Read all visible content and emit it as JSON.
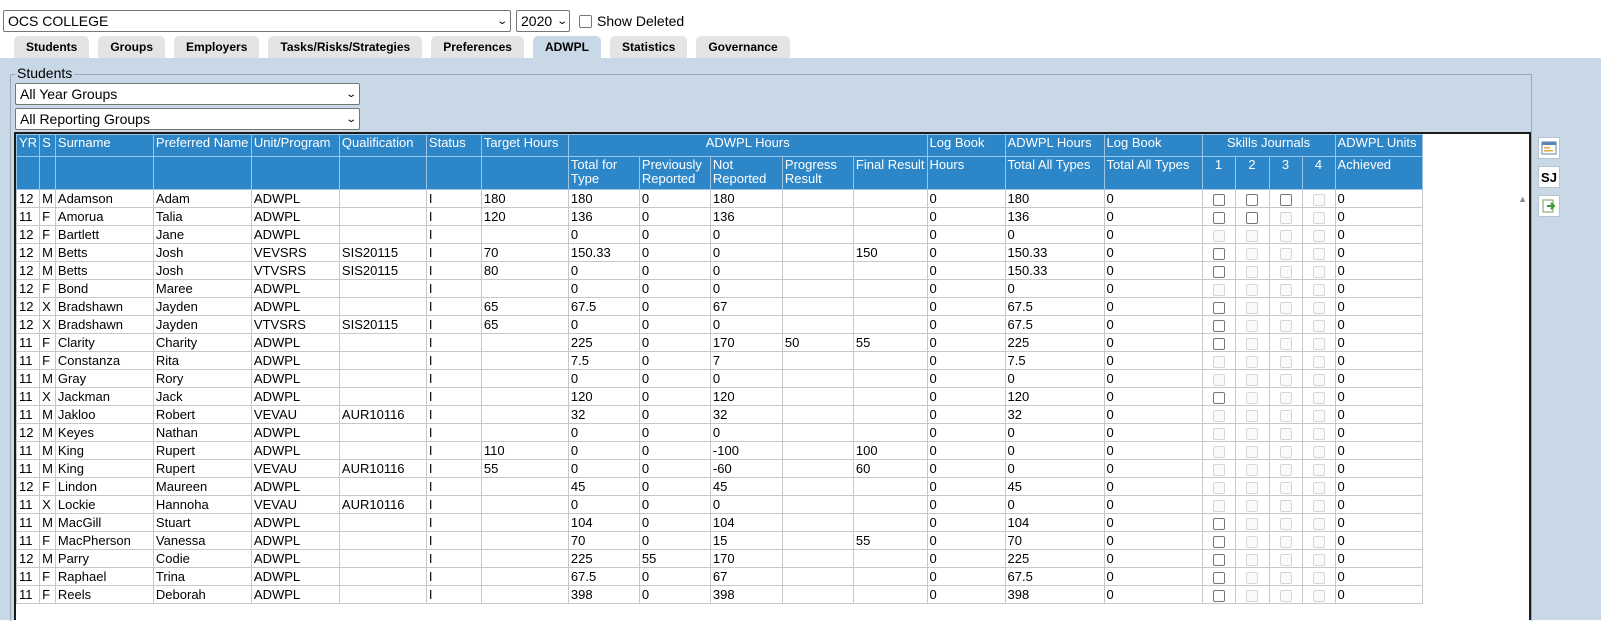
{
  "top": {
    "college": "OCS COLLEGE",
    "year": "2020",
    "show_deleted_label": "Show Deleted"
  },
  "tabs": [
    {
      "label": "Students",
      "active": false
    },
    {
      "label": "Groups",
      "active": false
    },
    {
      "label": "Employers",
      "active": false
    },
    {
      "label": "Tasks/Risks/Strategies",
      "active": false
    },
    {
      "label": "Preferences",
      "active": false
    },
    {
      "label": "ADWPL",
      "active": true
    },
    {
      "label": "Statistics",
      "active": false
    },
    {
      "label": "Governance",
      "active": false
    }
  ],
  "students_section": {
    "legend": "Students",
    "year_group_filter": "All Year Groups",
    "reporting_group_filter": "All Reporting Groups"
  },
  "headers": {
    "yr": "YR",
    "s": "S",
    "surname": "Surname",
    "preferred_name": "Preferred Name",
    "unit_program": "Unit/Program",
    "qualification": "Qualification",
    "status": "Status",
    "target_hours": "Target Hours",
    "adwpl_hours_group": "ADWPL Hours",
    "log_book_group": "Log Book",
    "adwpl_hours_group2": "ADWPL Hours",
    "log_book_group2": "Log Book",
    "skills_journals": "Skills Journals",
    "adwpl_units": "ADWPL Units",
    "total_for_type": "Total for Type",
    "previously_reported": "Previously Reported",
    "not_reported": "Not Reported",
    "progress_result": "Progress Result",
    "final_result": "Final Result",
    "hours": "Hours",
    "total_all_types": "Total All Types",
    "total_all_types2": "Total All Types",
    "sj1": "1",
    "sj2": "2",
    "sj3": "3",
    "sj4": "4",
    "achieved": "Achieved"
  },
  "rows": [
    {
      "yr": "12",
      "s": "M",
      "surname": "Adamson",
      "pref": "Adam",
      "unit": "ADWPL",
      "qual": "",
      "status": "I",
      "target": "180",
      "total": "180",
      "prev": "0",
      "notrep": "180",
      "progress": "",
      "final": "",
      "logbook": "0",
      "adwpl_all": "180",
      "logbook_all": "0",
      "sj": [
        "e",
        "e",
        "e",
        "d"
      ],
      "units": "0"
    },
    {
      "yr": "11",
      "s": "F",
      "surname": "Amorua",
      "pref": "Talia",
      "unit": "ADWPL",
      "qual": "",
      "status": "I",
      "target": "120",
      "total": "136",
      "prev": "0",
      "notrep": "136",
      "progress": "",
      "final": "",
      "logbook": "0",
      "adwpl_all": "136",
      "logbook_all": "0",
      "sj": [
        "e",
        "e",
        "d",
        "d"
      ],
      "units": "0"
    },
    {
      "yr": "12",
      "s": "F",
      "surname": "Bartlett",
      "pref": "Jane",
      "unit": "ADWPL",
      "qual": "",
      "status": "I",
      "target": "",
      "total": "0",
      "prev": "0",
      "notrep": "0",
      "progress": "",
      "final": "",
      "logbook": "0",
      "adwpl_all": "0",
      "logbook_all": "0",
      "sj": [
        "d",
        "d",
        "d",
        "d"
      ],
      "units": "0"
    },
    {
      "yr": "12",
      "s": "M",
      "surname": "Betts",
      "pref": "Josh",
      "unit": "VEVSRS",
      "qual": "SIS20115",
      "status": "I",
      "target": "70",
      "total": "150.33",
      "prev": "0",
      "notrep": "0",
      "progress": "",
      "final": "150",
      "logbook": "0",
      "adwpl_all": "150.33",
      "logbook_all": "0",
      "sj": [
        "e",
        "d",
        "d",
        "d"
      ],
      "units": "0"
    },
    {
      "yr": "12",
      "s": "M",
      "surname": "Betts",
      "pref": "Josh",
      "unit": "VTVSRS",
      "qual": "SIS20115",
      "status": "I",
      "target": "80",
      "total": "0",
      "prev": "0",
      "notrep": "0",
      "progress": "",
      "final": "",
      "logbook": "0",
      "adwpl_all": "150.33",
      "logbook_all": "0",
      "sj": [
        "e",
        "d",
        "d",
        "d"
      ],
      "units": "0"
    },
    {
      "yr": "12",
      "s": "F",
      "surname": "Bond",
      "pref": "Maree",
      "unit": "ADWPL",
      "qual": "",
      "status": "I",
      "target": "",
      "total": "0",
      "prev": "0",
      "notrep": "0",
      "progress": "",
      "final": "",
      "logbook": "0",
      "adwpl_all": "0",
      "logbook_all": "0",
      "sj": [
        "d",
        "d",
        "d",
        "d"
      ],
      "units": "0"
    },
    {
      "yr": "12",
      "s": "X",
      "surname": "Bradshawn",
      "pref": "Jayden",
      "unit": "ADWPL",
      "qual": "",
      "status": "I",
      "target": "65",
      "total": "67.5",
      "prev": "0",
      "notrep": "67",
      "progress": "",
      "final": "",
      "logbook": "0",
      "adwpl_all": "67.5",
      "logbook_all": "0",
      "sj": [
        "e",
        "d",
        "d",
        "d"
      ],
      "units": "0"
    },
    {
      "yr": "12",
      "s": "X",
      "surname": "Bradshawn",
      "pref": "Jayden",
      "unit": "VTVSRS",
      "qual": "SIS20115",
      "status": "I",
      "target": "65",
      "total": "0",
      "prev": "0",
      "notrep": "0",
      "progress": "",
      "final": "",
      "logbook": "0",
      "adwpl_all": "67.5",
      "logbook_all": "0",
      "sj": [
        "e",
        "d",
        "d",
        "d"
      ],
      "units": "0"
    },
    {
      "yr": "11",
      "s": "F",
      "surname": "Clarity",
      "pref": "Charity",
      "unit": "ADWPL",
      "qual": "",
      "status": "I",
      "target": "",
      "total": "225",
      "prev": "0",
      "notrep": "170",
      "progress": "50",
      "final": "55",
      "logbook": "0",
      "adwpl_all": "225",
      "logbook_all": "0",
      "sj": [
        "e",
        "d",
        "d",
        "d"
      ],
      "units": "0"
    },
    {
      "yr": "11",
      "s": "F",
      "surname": "Constanza",
      "pref": "Rita",
      "unit": "ADWPL",
      "qual": "",
      "status": "I",
      "target": "",
      "total": "7.5",
      "prev": "0",
      "notrep": "7",
      "progress": "",
      "final": "",
      "logbook": "0",
      "adwpl_all": "7.5",
      "logbook_all": "0",
      "sj": [
        "d",
        "d",
        "d",
        "d"
      ],
      "units": "0"
    },
    {
      "yr": "11",
      "s": "M",
      "surname": "Gray",
      "pref": "Rory",
      "unit": "ADWPL",
      "qual": "",
      "status": "I",
      "target": "",
      "total": "0",
      "prev": "0",
      "notrep": "0",
      "progress": "",
      "final": "",
      "logbook": "0",
      "adwpl_all": "0",
      "logbook_all": "0",
      "sj": [
        "d",
        "d",
        "d",
        "d"
      ],
      "units": "0"
    },
    {
      "yr": "11",
      "s": "X",
      "surname": "Jackman",
      "pref": "Jack",
      "unit": "ADWPL",
      "qual": "",
      "status": "I",
      "target": "",
      "total": "120",
      "prev": "0",
      "notrep": "120",
      "progress": "",
      "final": "",
      "logbook": "0",
      "adwpl_all": "120",
      "logbook_all": "0",
      "sj": [
        "e",
        "d",
        "d",
        "d"
      ],
      "units": "0"
    },
    {
      "yr": "11",
      "s": "M",
      "surname": "Jakloo",
      "pref": "Robert",
      "unit": "VEVAU",
      "qual": "AUR10116",
      "status": "I",
      "target": "",
      "total": "32",
      "prev": "0",
      "notrep": "32",
      "progress": "",
      "final": "",
      "logbook": "0",
      "adwpl_all": "32",
      "logbook_all": "0",
      "sj": [
        "d",
        "d",
        "d",
        "d"
      ],
      "units": "0"
    },
    {
      "yr": "12",
      "s": "M",
      "surname": "Keyes",
      "pref": "Nathan",
      "unit": "ADWPL",
      "qual": "",
      "status": "I",
      "target": "",
      "total": "0",
      "prev": "0",
      "notrep": "0",
      "progress": "",
      "final": "",
      "logbook": "0",
      "adwpl_all": "0",
      "logbook_all": "0",
      "sj": [
        "d",
        "d",
        "d",
        "d"
      ],
      "units": "0"
    },
    {
      "yr": "11",
      "s": "M",
      "surname": "King",
      "pref": "Rupert",
      "unit": "ADWPL",
      "qual": "",
      "status": "I",
      "target": "110",
      "total": "0",
      "prev": "0",
      "notrep": "-100",
      "progress": "",
      "final": "100",
      "logbook": "0",
      "adwpl_all": "0",
      "logbook_all": "0",
      "sj": [
        "d",
        "d",
        "d",
        "d"
      ],
      "units": "0"
    },
    {
      "yr": "11",
      "s": "M",
      "surname": "King",
      "pref": "Rupert",
      "unit": "VEVAU",
      "qual": "AUR10116",
      "status": "I",
      "target": "55",
      "total": "0",
      "prev": "0",
      "notrep": "-60",
      "progress": "",
      "final": "60",
      "logbook": "0",
      "adwpl_all": "0",
      "logbook_all": "0",
      "sj": [
        "d",
        "d",
        "d",
        "d"
      ],
      "units": "0"
    },
    {
      "yr": "12",
      "s": "F",
      "surname": "Lindon",
      "pref": "Maureen",
      "unit": "ADWPL",
      "qual": "",
      "status": "I",
      "target": "",
      "total": "45",
      "prev": "0",
      "notrep": "45",
      "progress": "",
      "final": "",
      "logbook": "0",
      "adwpl_all": "45",
      "logbook_all": "0",
      "sj": [
        "d",
        "d",
        "d",
        "d"
      ],
      "units": "0"
    },
    {
      "yr": "11",
      "s": "X",
      "surname": "Lockie",
      "pref": "Hannoha",
      "unit": "VEVAU",
      "qual": "AUR10116",
      "status": "I",
      "target": "",
      "total": "0",
      "prev": "0",
      "notrep": "0",
      "progress": "",
      "final": "",
      "logbook": "0",
      "adwpl_all": "0",
      "logbook_all": "0",
      "sj": [
        "d",
        "d",
        "d",
        "d"
      ],
      "units": "0"
    },
    {
      "yr": "11",
      "s": "M",
      "surname": "MacGill",
      "pref": "Stuart",
      "unit": "ADWPL",
      "qual": "",
      "status": "I",
      "target": "",
      "total": "104",
      "prev": "0",
      "notrep": "104",
      "progress": "",
      "final": "",
      "logbook": "0",
      "adwpl_all": "104",
      "logbook_all": "0",
      "sj": [
        "e",
        "d",
        "d",
        "d"
      ],
      "units": "0"
    },
    {
      "yr": "11",
      "s": "F",
      "surname": "MacPherson",
      "pref": "Vanessa",
      "unit": "ADWPL",
      "qual": "",
      "status": "I",
      "target": "",
      "total": "70",
      "prev": "0",
      "notrep": "15",
      "progress": "",
      "final": "55",
      "logbook": "0",
      "adwpl_all": "70",
      "logbook_all": "0",
      "sj": [
        "e",
        "d",
        "d",
        "d"
      ],
      "units": "0"
    },
    {
      "yr": "12",
      "s": "M",
      "surname": "Parry",
      "pref": "Codie",
      "unit": "ADWPL",
      "qual": "",
      "status": "I",
      "target": "",
      "total": "225",
      "prev": "55",
      "notrep": "170",
      "progress": "",
      "final": "",
      "logbook": "0",
      "adwpl_all": "225",
      "logbook_all": "0",
      "sj": [
        "e",
        "d",
        "d",
        "d"
      ],
      "units": "0"
    },
    {
      "yr": "11",
      "s": "F",
      "surname": "Raphael",
      "pref": "Trina",
      "unit": "ADWPL",
      "qual": "",
      "status": "I",
      "target": "",
      "total": "67.5",
      "prev": "0",
      "notrep": "67",
      "progress": "",
      "final": "",
      "logbook": "0",
      "adwpl_all": "67.5",
      "logbook_all": "0",
      "sj": [
        "e",
        "d",
        "d",
        "d"
      ],
      "units": "0"
    },
    {
      "yr": "11",
      "s": "F",
      "surname": "Reels",
      "pref": "Deborah",
      "unit": "ADWPL",
      "qual": "",
      "status": "I",
      "target": "",
      "total": "398",
      "prev": "0",
      "notrep": "398",
      "progress": "",
      "final": "",
      "logbook": "0",
      "adwpl_all": "398",
      "logbook_all": "0",
      "sj": [
        "e",
        "d",
        "d",
        "d"
      ],
      "units": "0"
    }
  ],
  "side_icons": [
    "report-icon",
    "skills-journal-icon",
    "export-icon"
  ],
  "side_icon_sj_text": "SJ",
  "colors": {
    "header_blue": "#2d86c8",
    "panel_bg": "#c9d8e6",
    "tab_bg": "#e4e4e4"
  }
}
